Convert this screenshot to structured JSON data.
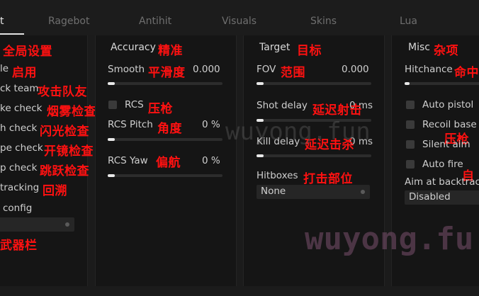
{
  "tabs": [
    "t",
    "Ragebot",
    "Antihit",
    "Visuals",
    "Skins",
    "Lua"
  ],
  "active_tab": "t",
  "left_panel": {
    "heading_annotation": "全局设置",
    "rows": [
      {
        "label": "le",
        "annotation": "启用"
      },
      {
        "label": "ck team",
        "annotation": "攻击队友"
      },
      {
        "label": "ke check",
        "annotation": "烟雾检查"
      },
      {
        "label": "h check",
        "annotation": "闪光检查"
      },
      {
        "label": "pe check",
        "annotation": "开镜检查"
      },
      {
        "label": "p check",
        "annotation": "跳跃检查"
      },
      {
        "label": "tracking",
        "annotation": "回溯"
      },
      {
        "label": "config",
        "annotation": ""
      }
    ],
    "bottom_annotation": "武器栏"
  },
  "accuracy": {
    "title": "Accuracy",
    "title_annotation": "精准",
    "smooth": {
      "label": "Smooth",
      "annotation": "平滑度",
      "value": "0.000",
      "fraction": 0.06
    },
    "rcs": {
      "label": "RCS",
      "annotation": "压枪"
    },
    "rcs_pitch": {
      "label": "RCS Pitch",
      "annotation": "角度",
      "value": "0 %",
      "fraction": 0.06
    },
    "rcs_yaw": {
      "label": "RCS Yaw",
      "annotation": "偏航",
      "value": "0 %",
      "fraction": 0.06
    }
  },
  "target": {
    "title": "Target",
    "title_annotation": "目标",
    "fov": {
      "label": "FOV",
      "annotation": "范围",
      "value": "0.000",
      "fraction": 0.06
    },
    "shot_delay": {
      "label": "Shot delay",
      "annotation": "延迟射击",
      "value": "0 ms",
      "fraction": 0.06
    },
    "kill_delay": {
      "label": "Kill delay",
      "annotation": "延迟击杀",
      "value": "0 ms",
      "fraction": 0.06
    },
    "hitboxes": {
      "label": "Hitboxes",
      "annotation": "打击部位",
      "value": "None"
    }
  },
  "misc": {
    "title": "Misc",
    "title_annotation": "杂项",
    "hitchance": {
      "label": "Hitchance",
      "annotation": "命中",
      "fraction": 0.06
    },
    "auto_pistol": {
      "label": "Auto pistol"
    },
    "recoil_based": {
      "label": "Recoil base",
      "annotation": "压枪"
    },
    "silent_aim": {
      "label": "Silent aim"
    },
    "auto_fire": {
      "label": "Auto fire",
      "annotation": "自"
    },
    "aim_at_backtrack": {
      "label": "Aim at backtrac"
    },
    "aim_dropdown": {
      "value": "Disabled"
    }
  },
  "watermark": {
    "small": "wuyong.fun",
    "large": "wuyong.fu"
  },
  "colors": {
    "background": "#1b1b1b",
    "panel": "#151515",
    "annotation": "#ff1111",
    "slider_fill": "#e8e8e8"
  }
}
